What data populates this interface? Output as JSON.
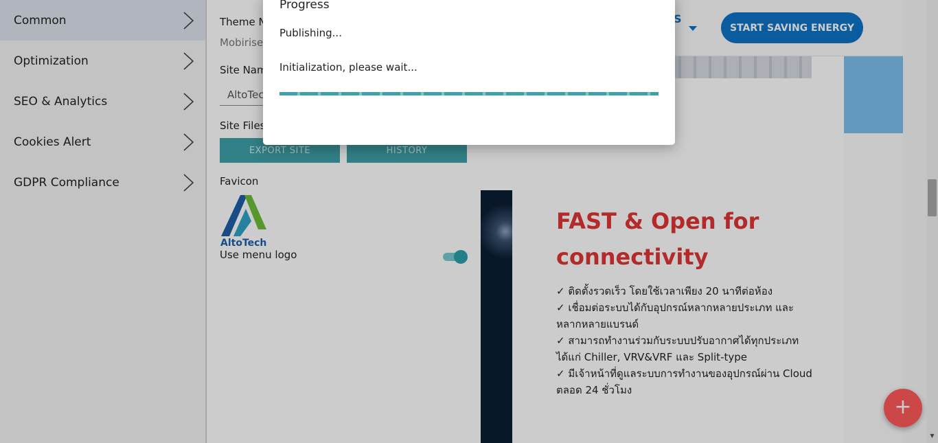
{
  "left_menu": {
    "items": [
      {
        "label": "Common",
        "active": true
      },
      {
        "label": "Optimization"
      },
      {
        "label": "SEO & Analytics"
      },
      {
        "label": "Cookies Alert"
      },
      {
        "label": "GDPR Compliance"
      }
    ]
  },
  "settings": {
    "theme_name_label": "Theme Na",
    "theme_name_value": "Mobirise",
    "site_name_label": "Site Nam",
    "site_name_value": "AltoTech",
    "site_files_label": "Site Files",
    "export_button": "EXPORT SITE",
    "history_button": "HISTORY",
    "favicon_label": "Favicon",
    "favicon_logo_text": "AltoTech",
    "use_menu_logo_label": "Use menu logo",
    "use_menu_logo_on": true
  },
  "preview": {
    "nav_partial_text": "S",
    "cta_button": "START SAVING ENERGY",
    "hero_title": "FAST & Open for connectivity",
    "features": [
      "✓ ติดตั้งรวดเร็ว โดยใช้เวลาเพียง 20 นาทีต่อห้อง",
      "✓ เชื่อมต่อระบบได้กับอุปกรณ์หลากหลายประเภท และหลากหลายแบรนด์",
      "✓ สามารถทำงานร่วมกับระบบปรับอากาศได้ทุกประเภท ได้แก่ Chiller, VRV&VRF และ Split-type",
      "✓ มีเจ้าหน้าที่ดูแลระบบการทำงานของอุปกรณ์ผ่าน Cloud ตลอด 24 ชั่วโมง"
    ],
    "colors": {
      "cta": "#0e72c7",
      "title": "#e03535",
      "fab": "#ff5b5b"
    }
  },
  "fab": {
    "icon": "plus-icon",
    "label": "+"
  },
  "dialog": {
    "title": "Progress",
    "status": "Publishing...",
    "message": "Initialization, please wait...",
    "progress_percent": 100
  }
}
